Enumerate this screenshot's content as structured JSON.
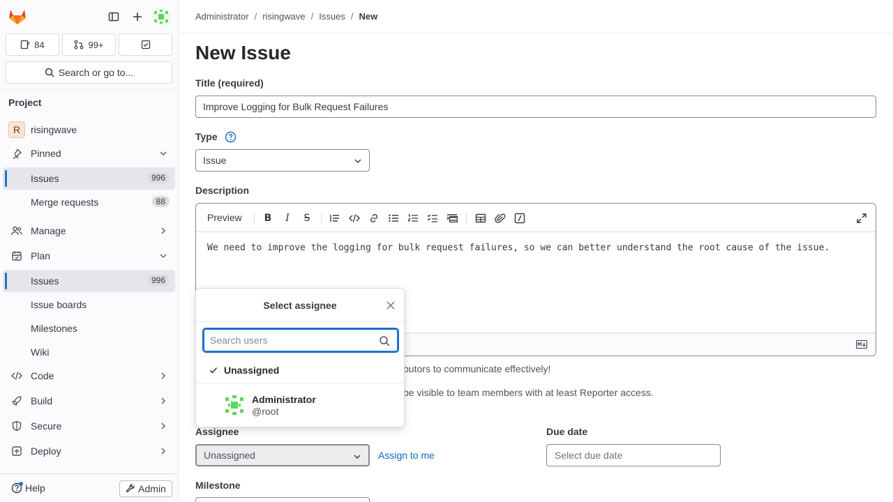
{
  "sidebar": {
    "counts": {
      "issues": "84",
      "merge_requests": "99+"
    },
    "search_label": "Search or go to...",
    "project_heading": "Project",
    "project_initial": "R",
    "project_name": "risingwave",
    "items": [
      {
        "label": "Pinned"
      },
      {
        "label": "Issues",
        "badge": "996"
      },
      {
        "label": "Merge requests",
        "badge": "88"
      },
      {
        "label": "Manage"
      },
      {
        "label": "Plan"
      },
      {
        "label": "Issues",
        "badge": "996"
      },
      {
        "label": "Issue boards"
      },
      {
        "label": "Milestones"
      },
      {
        "label": "Wiki"
      },
      {
        "label": "Code"
      },
      {
        "label": "Build"
      },
      {
        "label": "Secure"
      },
      {
        "label": "Deploy"
      }
    ],
    "help_label": "Help",
    "admin_label": "Admin"
  },
  "breadcrumb": [
    "Administrator",
    "risingwave",
    "Issues",
    "New"
  ],
  "page_title": "New Issue",
  "form": {
    "title_label": "Title (required)",
    "title_value": "Improve Logging for Bulk Request Failures",
    "type_label": "Type",
    "type_value": "Issue",
    "description_label": "Description",
    "preview_label": "Preview",
    "description_text": "We need to improve the logging for bulk request failures, so we can better understand the root cause of the issue.",
    "help_partial_1": "butors to communicate effectively!",
    "help_partial_2": "be visible to team members with at least Reporter access.",
    "assignee_label": "Assignee",
    "assignee_value": "Unassigned",
    "assign_to_me": "Assign to me",
    "due_date_label": "Due date",
    "due_date_placeholder": "Select due date",
    "milestone_label": "Milestone"
  },
  "assignee_dropdown": {
    "title": "Select assignee",
    "search_placeholder": "Search users",
    "unassigned": "Unassigned",
    "user_name": "Administrator",
    "user_handle": "@root"
  },
  "colors": {
    "accent": "#1f75cb",
    "link": "#1068bf",
    "logo": "#e24329"
  }
}
